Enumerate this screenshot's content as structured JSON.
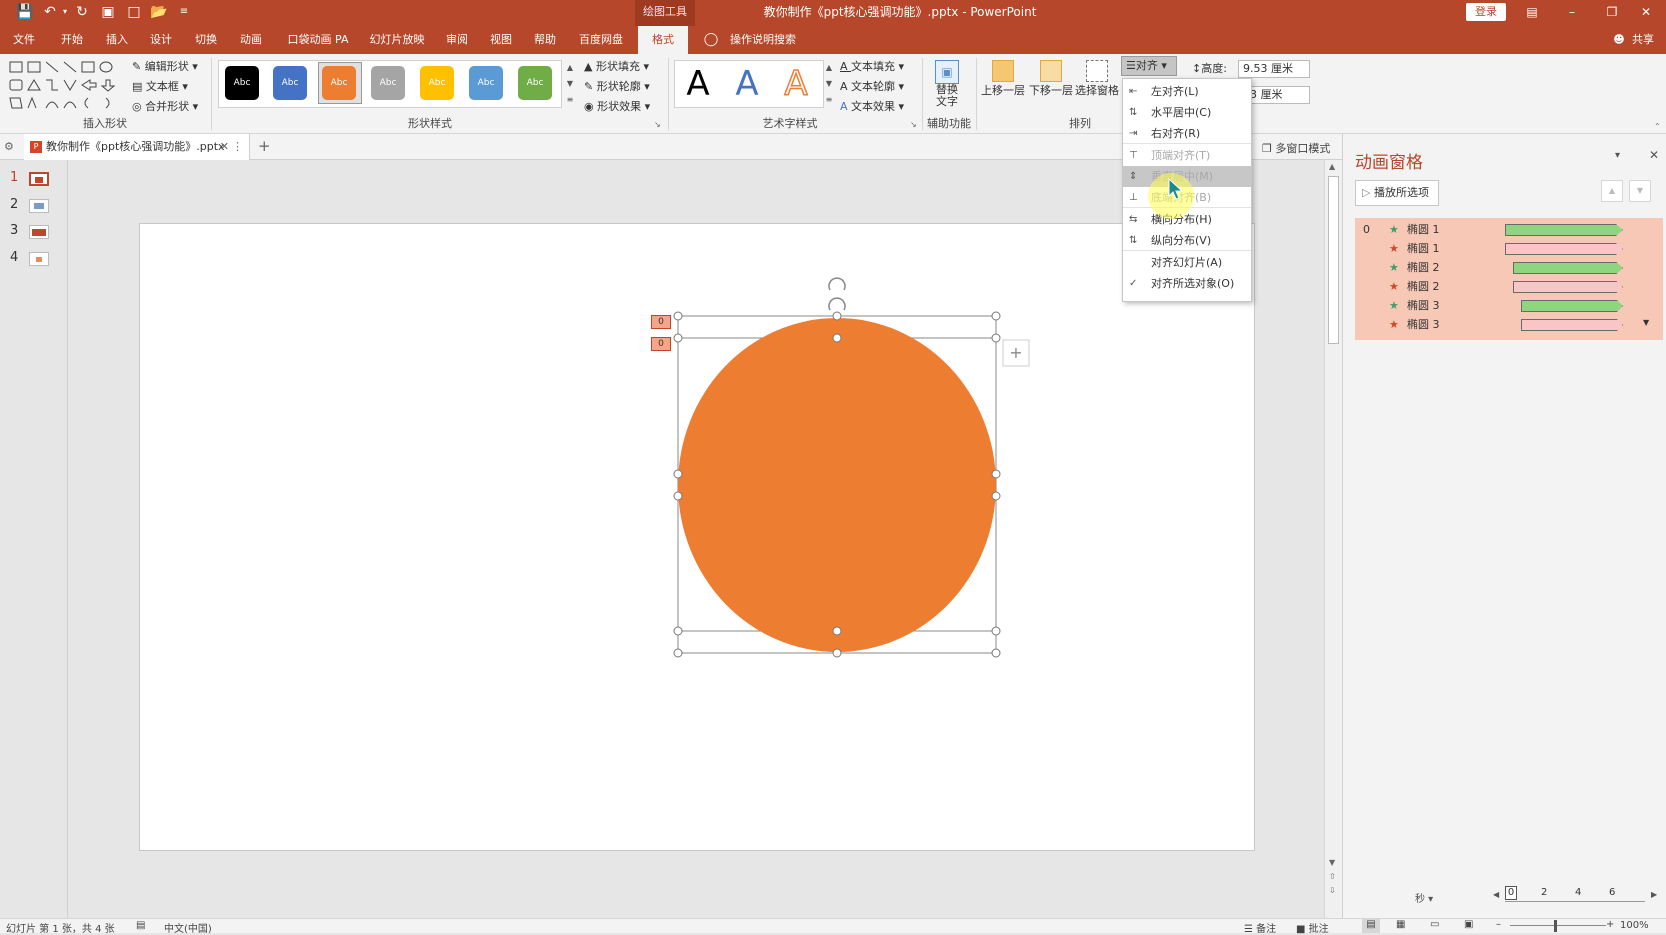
{
  "titlebar": {
    "context_tools": "绘图工具",
    "doc_title": "教你制作《ppt核心强调功能》.pptx  -  PowerPoint",
    "login": "登录",
    "quick_access": [
      "save",
      "undo",
      "redo",
      "present",
      "new",
      "open",
      "customize"
    ]
  },
  "menu": {
    "tabs": [
      "文件",
      "开始",
      "插入",
      "设计",
      "切换",
      "动画",
      "口袋动画 PA",
      "幻灯片放映",
      "审阅",
      "视图",
      "帮助",
      "百度网盘",
      "格式"
    ],
    "active_tab": "格式",
    "tell_me": "操作说明搜索",
    "share": "共享"
  },
  "ribbon": {
    "insert_shapes": {
      "label": "插入形状",
      "edit_shape": "编辑形状",
      "textbox": "文本框",
      "merge": "合并形状"
    },
    "shape_styles": {
      "label": "形状样式",
      "swatches": [
        {
          "text": "Abc",
          "color": "#000000"
        },
        {
          "text": "Abc",
          "color": "#4472c4"
        },
        {
          "text": "Abc",
          "color": "#ed7d31"
        },
        {
          "text": "Abc",
          "color": "#a5a5a5"
        },
        {
          "text": "Abc",
          "color": "#ffc000"
        },
        {
          "text": "Abc",
          "color": "#5b9bd5"
        },
        {
          "text": "Abc",
          "color": "#70ad47"
        }
      ],
      "fill": "形状填充",
      "outline": "形状轮廓",
      "effects": "形状效果"
    },
    "wordart": {
      "label": "艺术字样式",
      "letters": [
        "A",
        "A",
        "A"
      ],
      "text_fill": "文本填充",
      "text_outline": "文本轮廓",
      "text_effects": "文本效果"
    },
    "accessibility": {
      "label": "辅助功能",
      "alt_text_1": "替换",
      "alt_text_2": "文字"
    },
    "arrange": {
      "label": "排列",
      "bring_forward": "上移一层",
      "send_backward": "下移一层",
      "selection_pane": "选择窗格",
      "align": "对齐"
    },
    "size": {
      "height_label": "高度:",
      "height_value": "9.53 厘米",
      "width_value": "63 厘米"
    }
  },
  "tabstrip": {
    "doc_tab": "教你制作《ppt核心强调功能》.pptx",
    "multi_window": "多窗口模式"
  },
  "thumbnails": [
    "1",
    "2",
    "3",
    "4"
  ],
  "align_menu": {
    "items": [
      {
        "label": "左对齐(L)",
        "enabled": true,
        "icon": "align-left-icon"
      },
      {
        "label": "水平居中(C)",
        "enabled": true,
        "icon": "align-center-icon"
      },
      {
        "label": "右对齐(R)",
        "enabled": true,
        "icon": "align-right-icon"
      },
      {
        "label": "顶端对齐(T)",
        "enabled": false,
        "icon": "align-top-icon"
      },
      {
        "label": "垂直居中(M)",
        "enabled": false,
        "icon": "align-middle-icon",
        "highlighted": true
      },
      {
        "label": "底端对齐(B)",
        "enabled": false,
        "icon": "align-bottom-icon"
      },
      {
        "label": "横向分布(H)",
        "enabled": true,
        "icon": "distribute-horizontal-icon"
      },
      {
        "label": "纵向分布(V)",
        "enabled": true,
        "icon": "distribute-vertical-icon"
      },
      {
        "label": "对齐幻灯片(A)",
        "enabled": true,
        "icon": ""
      },
      {
        "label": "对齐所选对象(O)",
        "enabled": true,
        "icon": "check-icon"
      }
    ]
  },
  "slide": {
    "circle_color": "#ed7d31",
    "anim_tags": [
      "0",
      "0"
    ]
  },
  "animation_pane": {
    "title": "动画窗格",
    "play_selected": "播放所选项",
    "rows": [
      {
        "index": "0",
        "name": "椭圆 1",
        "effect": "emphasis",
        "bar": "green"
      },
      {
        "index": "",
        "name": "椭圆 1",
        "effect": "exit",
        "bar": "pink"
      },
      {
        "index": "",
        "name": "椭圆 2",
        "effect": "emphasis",
        "bar": "green"
      },
      {
        "index": "",
        "name": "椭圆 2",
        "effect": "exit",
        "bar": "pink"
      },
      {
        "index": "",
        "name": "椭圆 3",
        "effect": "emphasis",
        "bar": "green"
      },
      {
        "index": "",
        "name": "椭圆 3",
        "effect": "exit",
        "bar": "pink"
      }
    ],
    "seconds_label": "秒",
    "timeline": [
      "0",
      "2",
      "4",
      "6"
    ]
  },
  "statusbar": {
    "slide_info": "幻灯片 第 1 张，共 4 张",
    "language": "中文(中国)",
    "notes": "备注",
    "comments": "批注",
    "zoom": "100%"
  }
}
